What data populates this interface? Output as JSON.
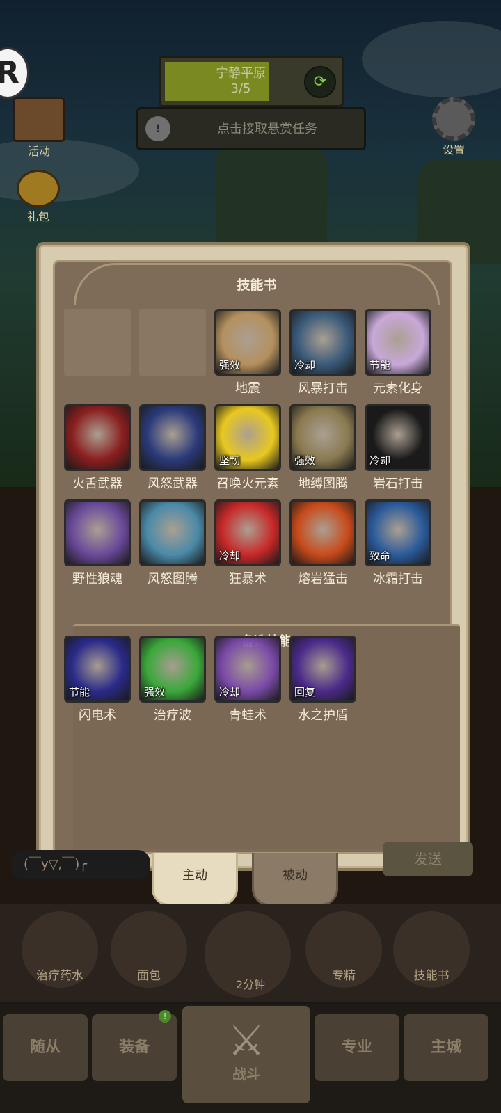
{
  "hud": {
    "stage_name": "宁静平原",
    "stage_progress": "3/5",
    "bounty_text": "点击接取悬赏任务",
    "events_label": "活动",
    "gift_label": "礼包",
    "settings_label": "设置",
    "logo_letter": "R"
  },
  "panel": {
    "title": "技能书",
    "reserve_title": "备选技能",
    "skills": [
      {
        "name": "",
        "badge": "",
        "icon": "empty-slot",
        "color": "#8a7762"
      },
      {
        "name": "",
        "badge": "",
        "icon": "empty-slot",
        "color": "#8a7762"
      },
      {
        "name": "地震",
        "badge": "强效",
        "icon": "earthquake-icon",
        "color": "#b4905e"
      },
      {
        "name": "风暴打击",
        "badge": "冷却",
        "icon": "hammer-icon",
        "color": "#3a5a7a"
      },
      {
        "name": "元素化身",
        "badge": "节能",
        "icon": "avatar-icon",
        "color": "#c8a8d8"
      },
      {
        "name": "火舌武器",
        "badge": "",
        "icon": "fire-axe-icon",
        "color": "#8a1e1e"
      },
      {
        "name": "风怒武器",
        "badge": "",
        "icon": "wind-claw-icon",
        "color": "#2a3a7a"
      },
      {
        "name": "召唤火元素",
        "badge": "坚韧",
        "icon": "fire-elemental-icon",
        "color": "#e8c820"
      },
      {
        "name": "地缚图腾",
        "badge": "强效",
        "icon": "earthbind-totem-icon",
        "color": "#8a7a50"
      },
      {
        "name": "岩石打击",
        "badge": "冷却",
        "icon": "rock-strike-icon",
        "color": "#1a1a1a"
      },
      {
        "name": "野性狼魂",
        "badge": "",
        "icon": "wolf-icon",
        "color": "#6a4a9a"
      },
      {
        "name": "风怒图腾",
        "badge": "",
        "icon": "wind-totem-icon",
        "color": "#4a8aa8"
      },
      {
        "name": "狂暴术",
        "badge": "冷却",
        "icon": "berserk-icon",
        "color": "#c82828"
      },
      {
        "name": "熔岩猛击",
        "badge": "",
        "icon": "lava-icon",
        "color": "#c84a1a"
      },
      {
        "name": "冰霜打击",
        "badge": "致命",
        "icon": "frost-icon",
        "color": "#2a5a9a"
      }
    ],
    "reserve_skills": [
      {
        "name": "闪电术",
        "badge": "节能",
        "icon": "lightning-icon",
        "color": "#2a2a8a"
      },
      {
        "name": "治疗波",
        "badge": "强效",
        "icon": "healing-wave-icon",
        "color": "#3aa83a"
      },
      {
        "name": "青蛙术",
        "badge": "冷却",
        "icon": "frog-icon",
        "color": "#7a4aa8"
      },
      {
        "name": "水之护盾",
        "badge": "回复",
        "icon": "water-shield-icon",
        "color": "#4a2a8a"
      }
    ]
  },
  "tabs": {
    "active": "主动",
    "inactive": "被动"
  },
  "chat": {
    "input_value": "(￣y▽,￣)╭",
    "send_label": "发送"
  },
  "quick_bar": {
    "potion": "治疗药水",
    "bread": "面包",
    "chest_timer": "2分钟",
    "mastery": "专精",
    "skillbook": "技能书"
  },
  "nav": {
    "followers": "随从",
    "equipment": "装备",
    "battle": "战斗",
    "profession": "专业",
    "city": "主城",
    "equipment_notice": "!"
  }
}
